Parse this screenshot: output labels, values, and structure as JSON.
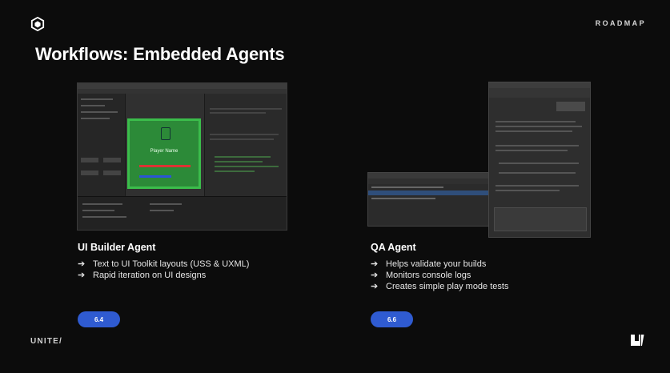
{
  "header": {
    "roadmap_label": "ROADMAP",
    "title": "Workflows: Embedded Agents"
  },
  "cards": [
    {
      "title": "UI Builder Agent",
      "bullets": [
        "Text to UI Toolkit layouts (USS & UXML)",
        "Rapid iteration on UI designs"
      ],
      "version": "6.4",
      "screenshot": {
        "player_name": "Player Name"
      }
    },
    {
      "title": "QA Agent",
      "bullets": [
        "Helps validate your builds",
        "Monitors console logs",
        "Creates simple play mode tests"
      ],
      "version": "6.6"
    }
  ],
  "footer": {
    "brand": "UNITE/"
  },
  "colors": {
    "background": "#0c0c0c",
    "pill": "#2f5bd1",
    "text": "#ffffff"
  },
  "icons": {
    "top_left": "unity-cube-icon",
    "bottom_right": "unity-u-icon",
    "bullet": "arrow-right-icon"
  }
}
